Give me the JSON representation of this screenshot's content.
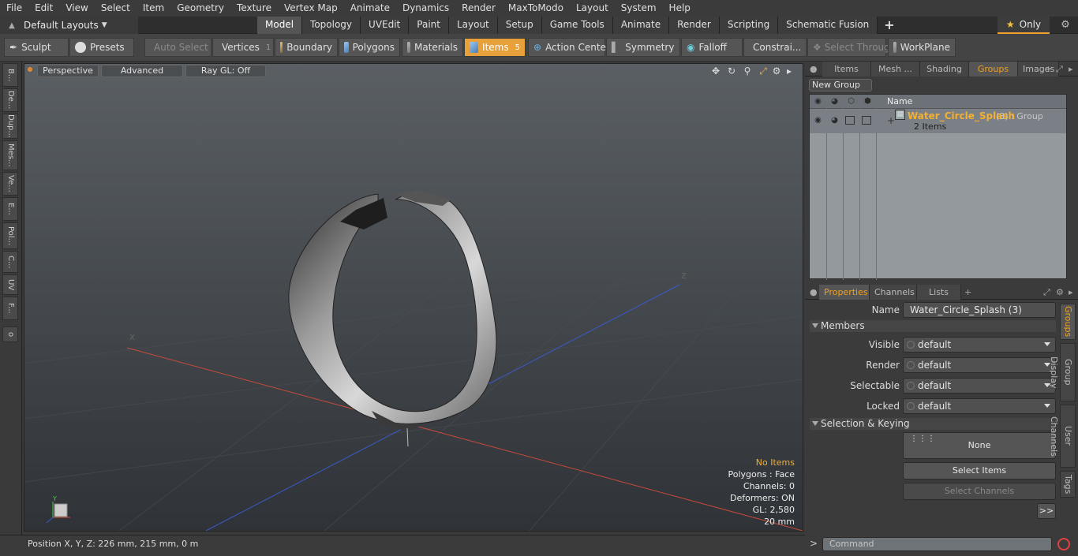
{
  "menu": [
    "File",
    "Edit",
    "View",
    "Select",
    "Item",
    "Geometry",
    "Texture",
    "Vertex Map",
    "Animate",
    "Dynamics",
    "Render",
    "MaxToModo",
    "Layout",
    "System",
    "Help"
  ],
  "layouts": {
    "label": "Default Layouts"
  },
  "mode_tabs": [
    "Model",
    "Topology",
    "UVEdit",
    "Paint",
    "Layout",
    "Setup",
    "Game Tools",
    "Animate",
    "Render",
    "Scripting",
    "Schematic Fusion"
  ],
  "only_label": "Only",
  "toolbar": {
    "sculpt": "Sculpt",
    "presets": "Presets",
    "auto_select": "Auto Select",
    "vertices": "Vertices",
    "vertices_count": "1",
    "boundary": "Boundary",
    "polygons": "Polygons",
    "materials": "Materials",
    "items": "Items",
    "items_count": "5",
    "action_center": "Action Center",
    "symmetry": "Symmetry",
    "falloff": "Falloff",
    "constraints": "Constrai...",
    "select_through": "Select Through",
    "workplane": "WorkPlane"
  },
  "left_tabs": [
    "B...",
    "De...",
    "Dup...",
    "Mes...",
    "Ve...",
    "E...",
    "Pol...",
    "C...",
    "UV",
    "F..."
  ],
  "viewport": {
    "perspective": "Perspective",
    "advanced": "Advanced",
    "raygl": "Ray GL: Off",
    "info": {
      "items": "No Items",
      "polygons": "Polygons : Face",
      "channels": "Channels: 0",
      "deformers": "Deformers: ON",
      "gl": "GL: 2,580",
      "scale": "20 mm"
    },
    "axis_x": "X",
    "axis_z": "Z",
    "gizmo_y": "Y"
  },
  "status": {
    "position": "Position X, Y, Z:  226 mm, 215 mm, 0 m"
  },
  "right_top_tabs": [
    "Items",
    "Mesh ...",
    "Shading",
    "Groups",
    "Images"
  ],
  "groups": {
    "new_group": "New Group",
    "col_name": "Name",
    "row": {
      "name": "Water_Circle_Splash",
      "count": "(3) : Group",
      "items": "2 Items"
    }
  },
  "props_tabs": [
    "Properties",
    "Channels",
    "Lists"
  ],
  "properties": {
    "name_label": "Name",
    "name_value": "Water_Circle_Splash (3)",
    "members": "Members",
    "visible": "Visible",
    "render": "Render",
    "selectable": "Selectable",
    "locked": "Locked",
    "default": "default",
    "selection_keying": "Selection & Keying",
    "none": "None",
    "select_items": "Select Items",
    "select_channels": "Select Channels",
    "more": ">>"
  },
  "right_vtabs": [
    "Groups",
    "Group Display",
    "User Channels",
    "Tags"
  ],
  "command": {
    "placeholder": "Command"
  }
}
